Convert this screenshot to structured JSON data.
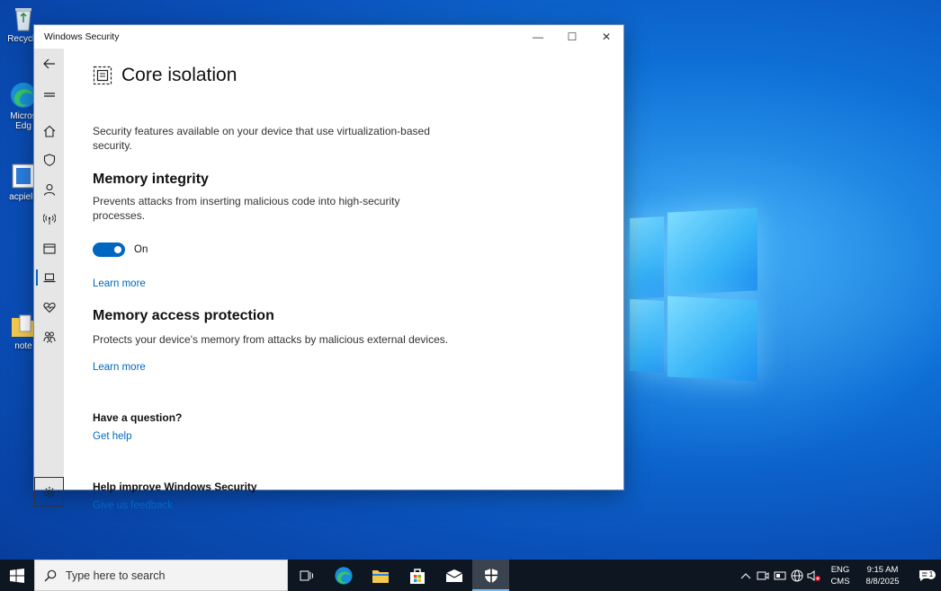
{
  "desktop": {
    "icons": [
      {
        "name": "recycle-bin",
        "label": "Recycle"
      },
      {
        "name": "edge",
        "label": "Micros Edg"
      },
      {
        "name": "acpi",
        "label": "acpielu"
      },
      {
        "name": "notes",
        "label": "note"
      }
    ]
  },
  "window": {
    "title": "Windows Security",
    "controls": {
      "minimize": "—",
      "maximize": "☐",
      "close": "✕"
    }
  },
  "sidebar": {
    "items": [
      {
        "name": "back",
        "icon": "back-arrow-icon"
      },
      {
        "name": "menu",
        "icon": "hamburger-icon"
      },
      {
        "name": "home",
        "icon": "home-icon"
      },
      {
        "name": "virus-protection",
        "icon": "shield-icon"
      },
      {
        "name": "account-protection",
        "icon": "person-icon"
      },
      {
        "name": "firewall",
        "icon": "wireless-icon"
      },
      {
        "name": "app-browser",
        "icon": "browser-window-icon"
      },
      {
        "name": "device-security",
        "icon": "laptop-icon"
      },
      {
        "name": "device-performance",
        "icon": "heart-icon"
      },
      {
        "name": "family-options",
        "icon": "family-icon"
      },
      {
        "name": "settings",
        "icon": "gear-icon"
      }
    ]
  },
  "content": {
    "title": "Core isolation",
    "description": "Security features available on your device that use virtualization-based security.",
    "memory_integrity": {
      "heading": "Memory integrity",
      "description": "Prevents attacks from inserting malicious code into high-security processes.",
      "toggle_state": "On",
      "learn_more": "Learn more"
    },
    "memory_access": {
      "heading": "Memory access protection",
      "description": "Protects your device's memory from attacks by malicious external devices.",
      "learn_more": "Learn more"
    },
    "question": {
      "heading": "Have a question?",
      "link": "Get help"
    },
    "improve": {
      "heading": "Help improve Windows Security",
      "link": "Give us feedback"
    }
  },
  "taskbar": {
    "search_placeholder": "Type here to search",
    "lang_top": "ENG",
    "lang_bottom": "CMS",
    "time": "9:15 AM",
    "date": "8/8/2025",
    "notification_count": "1"
  },
  "colors": {
    "accent": "#0067c0",
    "taskbar": "#0e1621"
  }
}
